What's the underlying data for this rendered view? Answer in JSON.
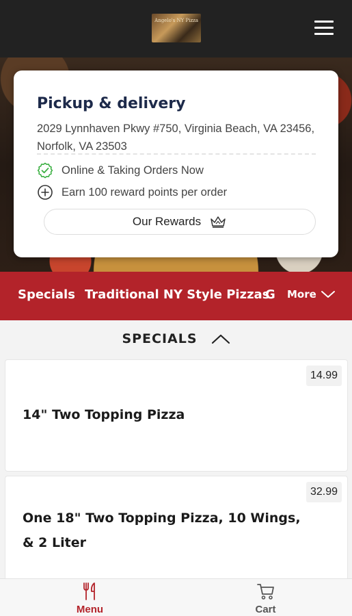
{
  "header": {
    "logo_text": "Angelo's NY Pizza",
    "menu_icon": "hamburger-menu-icon"
  },
  "store_card": {
    "title": "Pickup & delivery",
    "address": "2029 Lynnhaven Pkwy #750, Virginia Beach, VA 23456, Norfolk, VA 23503",
    "status": "Online & Taking Orders Now",
    "rewards_note": "Earn 100 reward points per order",
    "rewards_button": "Our Rewards",
    "status_color": "#3cb043"
  },
  "categories": {
    "items": [
      "Specials",
      "Traditional NY Style Pizzas",
      "G"
    ],
    "more_label": "More",
    "bar_color": "#b3232a"
  },
  "section": {
    "title": "SPECIALS"
  },
  "menu_items": [
    {
      "name": "14\" Two Topping Pizza",
      "price": "14.99"
    },
    {
      "name": "One 18\" Two Topping Pizza, 10 Wings, & 2 Liter",
      "price": "32.99"
    }
  ],
  "bottom_nav": {
    "menu_label": "Menu",
    "cart_label": "Cart",
    "active_color": "#b3232a",
    "inactive_color": "#555555"
  }
}
